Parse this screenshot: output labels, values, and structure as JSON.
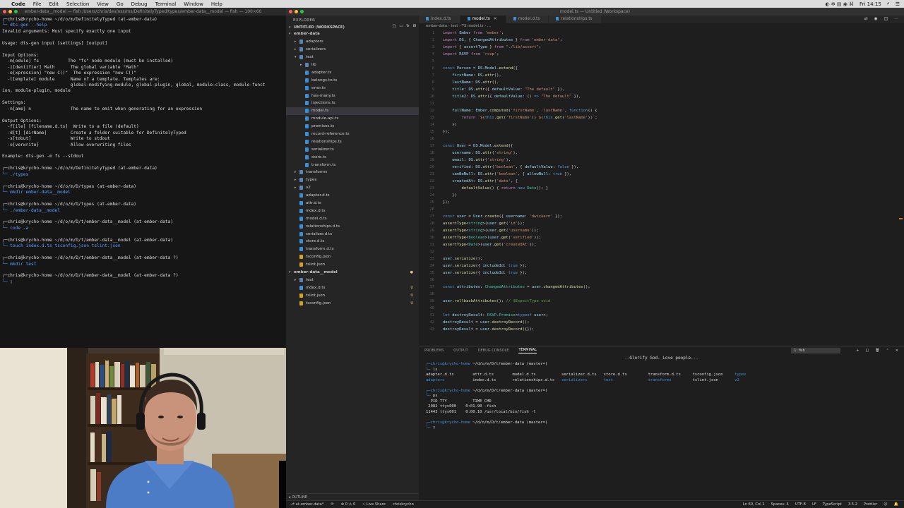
{
  "menubar": {
    "app": "Code",
    "items": [
      "File",
      "Edit",
      "Selection",
      "View",
      "Go",
      "Debug",
      "Terminal",
      "Window",
      "Help"
    ],
    "clock": "Fri 14:15"
  },
  "left_terminal": {
    "title": "ember-data__model — fish  /Users/chris/dev/oss/ms/DefinitelyTyped/types/ember-data__model — fish — 100×60",
    "lines": [
      {
        "type": "prompt",
        "text": "┌─chris@krycho-home ~/d/o/m/DefinitelyTyped (at-ember-data)"
      },
      {
        "type": "cmd",
        "text": "└─ dts-gen --help"
      },
      {
        "type": "out",
        "text": "Invalid arguments: Must specify exactly one input"
      },
      {
        "type": "out",
        "text": ""
      },
      {
        "type": "out",
        "text": "Usage: dts-gen input [settings] [output]"
      },
      {
        "type": "out",
        "text": ""
      },
      {
        "type": "out",
        "text": "Input Options:"
      },
      {
        "type": "out",
        "text": "  -m[odule] fs           The \"fs\" node module (must be installed)"
      },
      {
        "type": "out",
        "text": "  -i[dentifier] Math      The global variable \"Math\""
      },
      {
        "type": "out",
        "text": "  -e[xpression] \"new C()\"  The expression \"new C()\""
      },
      {
        "type": "out",
        "text": "  -t[emplate] module      Name of a template. Templates are:"
      },
      {
        "type": "out",
        "text": "                          global-modifying-module, global-plugin, global, module-class, module-funct"
      },
      {
        "type": "out",
        "text": "ion, module-plugin, module"
      },
      {
        "type": "out",
        "text": ""
      },
      {
        "type": "out",
        "text": "Settings:"
      },
      {
        "type": "out",
        "text": "  -n[ame] n               The name to emit when generating for an expression"
      },
      {
        "type": "out",
        "text": ""
      },
      {
        "type": "out",
        "text": "Output Options:"
      },
      {
        "type": "out",
        "text": "  -f[ile] [filename.d.ts]  Write to a file (default)"
      },
      {
        "type": "out",
        "text": "  -d[t] [dirName]         Create a folder suitable for DefinitelyTyped"
      },
      {
        "type": "out",
        "text": "  -s[tdout]               Write to stdout"
      },
      {
        "type": "out",
        "text": "  -o[verwrite]            Allow overwriting files"
      },
      {
        "type": "out",
        "text": ""
      },
      {
        "type": "out",
        "text": "Example: dts-gen -m fs --stdout"
      },
      {
        "type": "out",
        "text": ""
      },
      {
        "type": "prompt",
        "text": "┌─chris@krycho-home ~/d/o/m/DefinitelyTyped (at-ember-data)"
      },
      {
        "type": "cmd",
        "text": "└─ ./types"
      },
      {
        "type": "out",
        "text": ""
      },
      {
        "type": "prompt",
        "text": "┌─chris@krycho-home ~/d/o/m/D/types (at-ember-data)"
      },
      {
        "type": "cmd",
        "text": "└─ mkdir ember-data__model"
      },
      {
        "type": "out",
        "text": ""
      },
      {
        "type": "prompt",
        "text": "┌─chris@krycho-home ~/d/o/m/D/types (at-ember-data)"
      },
      {
        "type": "cmd",
        "text": "└─ ./ember-data__model"
      },
      {
        "type": "out",
        "text": ""
      },
      {
        "type": "prompt",
        "text": "┌─chris@krycho-home ~/d/o/m/D/t/ember-data__model (at-ember-data)"
      },
      {
        "type": "cmd",
        "text": "└─ code -a ."
      },
      {
        "type": "out",
        "text": ""
      },
      {
        "type": "prompt",
        "text": "┌─chris@krycho-home ~/d/o/m/D/t/ember-data__model (at-ember-data)"
      },
      {
        "type": "cmd",
        "text": "└─ touch index.d.ts tsconfig.json tslint.json"
      },
      {
        "type": "out",
        "text": ""
      },
      {
        "type": "prompt",
        "text": "┌─chris@krycho-home ~/d/o/m/D/t/ember-data__model (at-ember-data ?)"
      },
      {
        "type": "cmd",
        "text": "└─ mkdir test"
      },
      {
        "type": "out",
        "text": ""
      },
      {
        "type": "prompt",
        "text": "┌─chris@krycho-home ~/d/o/m/D/t/ember-data__model (at-ember-data ?)"
      },
      {
        "type": "cmd",
        "text": "└─ ▯"
      }
    ]
  },
  "vscode": {
    "title": "model.ts — Untitled (Workspace)",
    "explorer_label": "EXPLORER",
    "workspace_label": "UNTITLED (WORKSPACE)",
    "tree": [
      {
        "d": 1,
        "kind": "root",
        "open": true,
        "label": "ember-data"
      },
      {
        "d": 2,
        "kind": "folder",
        "open": false,
        "label": "adapters"
      },
      {
        "d": 2,
        "kind": "folder",
        "open": false,
        "label": "serializers"
      },
      {
        "d": 2,
        "kind": "folder",
        "open": true,
        "label": "test"
      },
      {
        "d": 3,
        "kind": "folder",
        "open": false,
        "label": "lib"
      },
      {
        "d": 3,
        "kind": "ts",
        "label": "adapter.ts"
      },
      {
        "d": 3,
        "kind": "ts",
        "label": "belongs-to.ts"
      },
      {
        "d": 3,
        "kind": "ts",
        "label": "error.ts"
      },
      {
        "d": 3,
        "kind": "ts",
        "label": "has-many.ts"
      },
      {
        "d": 3,
        "kind": "ts",
        "label": "injections.ts"
      },
      {
        "d": 3,
        "kind": "ts",
        "label": "model.ts",
        "selected": true
      },
      {
        "d": 3,
        "kind": "ts",
        "label": "module-api.ts"
      },
      {
        "d": 3,
        "kind": "ts",
        "label": "promises.ts"
      },
      {
        "d": 3,
        "kind": "ts",
        "label": "record-reference.ts"
      },
      {
        "d": 3,
        "kind": "ts",
        "label": "relationships.ts"
      },
      {
        "d": 3,
        "kind": "ts",
        "label": "serializer.ts"
      },
      {
        "d": 3,
        "kind": "ts",
        "label": "store.ts"
      },
      {
        "d": 3,
        "kind": "ts",
        "label": "transform.ts"
      },
      {
        "d": 2,
        "kind": "folder",
        "open": false,
        "label": "transforms"
      },
      {
        "d": 2,
        "kind": "folder",
        "open": false,
        "label": "types"
      },
      {
        "d": 2,
        "kind": "folder",
        "open": false,
        "label": "v2"
      },
      {
        "d": 2,
        "kind": "ts",
        "label": "adapter.d.ts"
      },
      {
        "d": 2,
        "kind": "ts",
        "label": "attr.d.ts"
      },
      {
        "d": 2,
        "kind": "ts",
        "label": "index.d.ts"
      },
      {
        "d": 2,
        "kind": "ts",
        "label": "model.d.ts"
      },
      {
        "d": 2,
        "kind": "ts",
        "label": "relationships.d.ts"
      },
      {
        "d": 2,
        "kind": "ts",
        "label": "serializer.d.ts"
      },
      {
        "d": 2,
        "kind": "ts",
        "label": "store.d.ts"
      },
      {
        "d": 2,
        "kind": "ts",
        "label": "transform.d.ts"
      },
      {
        "d": 2,
        "kind": "json",
        "label": "tsconfig.json"
      },
      {
        "d": 2,
        "kind": "json",
        "label": "tslint.json"
      },
      {
        "d": 1,
        "kind": "root",
        "open": true,
        "label": "ember-data__model",
        "badge": "●"
      },
      {
        "d": 2,
        "kind": "folder",
        "open": false,
        "label": "test"
      },
      {
        "d": 2,
        "kind": "ts",
        "label": "index.d.ts",
        "badge": "U"
      },
      {
        "d": 2,
        "kind": "json",
        "label": "tslint.json",
        "badge": "U"
      },
      {
        "d": 2,
        "kind": "json",
        "label": "tsconfig.json",
        "badge": "U"
      }
    ],
    "outline_label": "OUTLINE",
    "tabs": [
      {
        "label": "index.d.ts",
        "active": false
      },
      {
        "label": "model.ts",
        "active": true
      },
      {
        "label": "model.d.ts",
        "active": false
      },
      {
        "label": "relationships.ts",
        "active": false
      }
    ],
    "breadcrumbs": "ember-data › test › TS model.ts › ...",
    "code_lines": [
      "<span class=\"k\">import</span> <span class=\"v\">Ember</span> <span class=\"k\">from</span> <span class=\"s\">'ember'</span>;",
      "<span class=\"k\">import</span> <span class=\"v\">DS</span>, { <span class=\"v\">ChangedAttributes</span> } <span class=\"k\">from</span> <span class=\"s\">'ember-data'</span>;",
      "<span class=\"k\">import</span> { <span class=\"v\">assertType</span> } <span class=\"k\">from</span> <span class=\"s\">\"./lib/assert\"</span>;",
      "<span class=\"k\">import</span> <span class=\"v\">RSVP</span> <span class=\"k\">from</span> <span class=\"s\">'rsvp'</span>;",
      "",
      "<span class=\"kw\">const</span> <span class=\"v\">Person</span> = <span class=\"v\">DS</span>.<span class=\"v\">Model</span>.<span class=\"f\">extend</span>({",
      "    <span class=\"v\">firstName</span>: <span class=\"v\">DS</span>.<span class=\"f\">attr</span>(),",
      "    <span class=\"v\">lastName</span>: <span class=\"v\">DS</span>.<span class=\"f\">attr</span>(),",
      "    <span class=\"v\">title</span>: <span class=\"v\">DS</span>.<span class=\"f\">attr</span>({ <span class=\"v\">defaultValue</span>: <span class=\"s\">\"The default\"</span> }),",
      "    <span class=\"v\">title2</span>: <span class=\"v\">DS</span>.<span class=\"f\">attr</span>({ <span class=\"v\">defaultValue</span>: () <span class=\"kw\">=&gt;</span> <span class=\"s\">\"The default\"</span> }),",
      "",
      "    <span class=\"v\">fullName</span>: <span class=\"v\">Ember</span>.<span class=\"f\">computed</span>(<span class=\"s\">'firstName'</span>, <span class=\"s\">'lastName'</span>, <span class=\"kw\">function</span>() {",
      "        <span class=\"k\">return</span> <span class=\"s\">`${</span><span class=\"kw\">this</span>.<span class=\"f\">get</span>(<span class=\"s\">'firstName'</span>)<span class=\"s\">} ${</span><span class=\"kw\">this</span>.<span class=\"f\">get</span>(<span class=\"s\">'lastName'</span>)<span class=\"s\">}`</span>;",
      "    })",
      "});",
      "",
      "<span class=\"kw\">const</span> <span class=\"v\">User</span> = <span class=\"v\">DS</span>.<span class=\"v\">Model</span>.<span class=\"f\">extend</span>({",
      "    <span class=\"v\">username</span>: <span class=\"v\">DS</span>.<span class=\"f\">attr</span>(<span class=\"s\">'string'</span>),",
      "    <span class=\"v\">email</span>: <span class=\"v\">DS</span>.<span class=\"f\">attr</span>(<span class=\"s\">'string'</span>),",
      "    <span class=\"v\">verified</span>: <span class=\"v\">DS</span>.<span class=\"f\">attr</span>(<span class=\"s\">'boolean'</span>, { <span class=\"v\">defaultValue</span>: <span class=\"kw\">false</span> }),",
      "    <span class=\"v\">canBeNull</span>: <span class=\"v\">DS</span>.<span class=\"f\">attr</span>(<span class=\"s\">'boolean'</span>, { <span class=\"v\">allowNull</span>: <span class=\"kw\">true</span> }),",
      "    <span class=\"v\">createdAt</span>: <span class=\"v\">DS</span>.<span class=\"f\">attr</span>(<span class=\"s\">'date'</span>, {",
      "        <span class=\"f\">defaultValue</span>() { <span class=\"k\">return</span> <span class=\"kw\">new</span> <span class=\"t\">Date</span>(); }",
      "    })",
      "});",
      "",
      "<span class=\"kw\">const</span> <span class=\"v\">user</span> = <span class=\"v\">User</span>.<span class=\"f\">create</span>({ <span class=\"v\">username</span>: <span class=\"s\">'dwickern'</span> });",
      "<span class=\"f\">assertType</span>&lt;<span class=\"t\">string</span>&gt;(<span class=\"v\">user</span>.<span class=\"f\">get</span>(<span class=\"s\">'id'</span>));",
      "<span class=\"f\">assertType</span>&lt;<span class=\"t\">string</span>&gt;(<span class=\"v\">user</span>.<span class=\"f\">get</span>(<span class=\"s\">'username'</span>));",
      "<span class=\"f\">assertType</span>&lt;<span class=\"t\">boolean</span>&gt;(<span class=\"v\">user</span>.<span class=\"f\">get</span>(<span class=\"s\">'verified'</span>));",
      "<span class=\"f\">assertType</span>&lt;<span class=\"t\">Date</span>&gt;(<span class=\"v\">user</span>.<span class=\"f\">get</span>(<span class=\"s\">'createdAt'</span>));",
      "",
      "<span class=\"v\">user</span>.<span class=\"f\">serialize</span>();",
      "<span class=\"v\">user</span>.<span class=\"f\">serialize</span>({ <span class=\"v\">includeId</span>: <span class=\"kw\">true</span> });",
      "<span class=\"v\">user</span>.<span class=\"f\">serialize</span>({ <span class=\"v\">includeId</span>: <span class=\"kw\">true</span> });",
      "",
      "<span class=\"kw\">const</span> <span class=\"v\">attributes</span>: <span class=\"t\">ChangedAttributes</span> = <span class=\"v\">user</span>.<span class=\"f\">changedAttributes</span>();",
      "",
      "<span class=\"v\">user</span>.<span class=\"f\">rollbackAttributes</span>(); <span class=\"cm\">// $ExpectType void</span>",
      "",
      "<span class=\"kw\">let</span> <span class=\"v\">destroyResult</span>: <span class=\"t\">RSVP</span>.<span class=\"t\">Promise</span>&lt;<span class=\"kw\">typeof</span> <span class=\"v\">user</span>&gt;;",
      "<span class=\"v\">destroyResult</span> = <span class=\"v\">user</span>.<span class=\"f\">destroyRecord</span>();",
      "<span class=\"v\">destroyResult</span> = <span class=\"v\">user</span>.<span class=\"f\">destroyRecord</span>({});"
    ],
    "panel_tabs": [
      "PROBLEMS",
      "OUTPUT",
      "DEBUG CONSOLE",
      "TERMINAL"
    ],
    "terminal_select": "1: fish",
    "terminal_banner": "--Glorify God. Love people.--",
    "terminal_html": "<span class=\"c\">┌─chris@krycho-home</span> ~/d/o/m/D/t/ember-data (master=)\n<span class=\"c\">└─</span> ls\nadapter.d.ts        attr.d.ts        model.d.ts           serializer.d.ts   store.d.ts         transform.d.ts     tsconfig.json     <span class=\"cyan\">types</span>\n<span class=\"cyan\">adapters</span>            index.d.ts       relationships.d.ts   <span class=\"cyan\">serializers</span>       <span class=\"cyan\">test</span>               <span class=\"cyan\">transforms</span>         tslint.json       <span class=\"cyan\">v2</span>\n\n<span class=\"c\">┌─chris@krycho-home</span> ~/d/o/m/D/t/ember-data (master=)\n<span class=\"c\">└─</span> ps\n  PID TTY           TIME CMD\n 2082 ttys000    0:01.90 -fish\n11443 ttys001    0:00.10 /usr/local/bin/fish -l\n\n<span class=\"c\">┌─chris@krycho-home</span> ~/d/o/m/D/t/ember-data (master=)\n<span class=\"c\">└─</span> ▯",
    "status_left": [
      "⎇ at-ember-data*",
      "⟳",
      "⊗ 0  ⚠ 0",
      "⚡ Live Share",
      "chriskrycho"
    ],
    "status_right": [
      "Ln 60, Col 1",
      "Spaces: 4",
      "UTF-8",
      "LF",
      "TypeScript",
      "3.5.2",
      "Prettier",
      "☺",
      "🔔"
    ]
  },
  "colors": {
    "accent": "#3a8fd6",
    "folder": "#5a84b4",
    "json": "#d4a21e"
  }
}
